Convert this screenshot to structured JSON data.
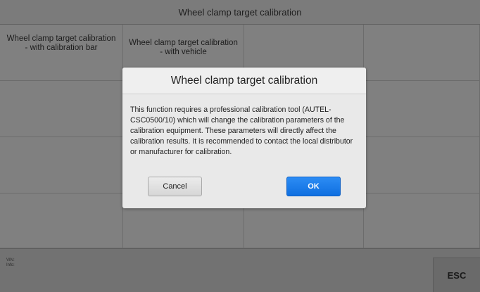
{
  "header": {
    "title": "Wheel clamp target calibration"
  },
  "menu": {
    "items": [
      "Wheel clamp target calibration - with calibration bar",
      "Wheel clamp target calibration - with vehicle"
    ]
  },
  "footer": {
    "vin_label": "VIN:",
    "info_label": "Info:",
    "esc_label": "ESC"
  },
  "dialog": {
    "title": "Wheel clamp target calibration",
    "message": "This function requires a professional calibration tool (AUTEL-CSC0500/10) which will change the calibration parameters of the calibration equipment. These parameters will directly affect the calibration results. It is recommended to contact the local distributor or manufacturer for calibration.",
    "cancel_label": "Cancel",
    "ok_label": "OK"
  },
  "colors": {
    "ok_button": "#1a7cf0",
    "overlay": "#7d7d7d"
  }
}
